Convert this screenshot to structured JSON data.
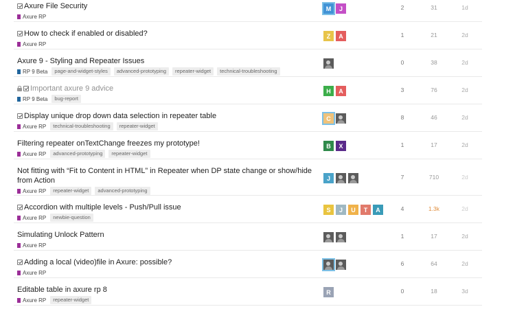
{
  "topics": [
    {
      "title": "Axure File Security",
      "status_icon": "checkbox-icon",
      "locked": false,
      "muted": false,
      "category": {
        "label": "Axure RP",
        "color": "#9b2e98"
      },
      "tags": [],
      "posters": [
        {
          "kind": "letter",
          "letter": "M",
          "color": "#4293d6",
          "ring": true
        },
        {
          "kind": "letter",
          "letter": "J",
          "color": "#c44fc6"
        }
      ],
      "replies": "2",
      "views": "31",
      "activity": "1d"
    },
    {
      "title": "How to check if enabled or disabled?",
      "status_icon": "checkbox-icon",
      "locked": false,
      "muted": false,
      "category": {
        "label": "Axure RP",
        "color": "#9b2e98"
      },
      "tags": [],
      "posters": [
        {
          "kind": "letter",
          "letter": "Z",
          "color": "#e8c44a"
        },
        {
          "kind": "letter",
          "letter": "A",
          "color": "#e45d5d"
        }
      ],
      "replies": "1",
      "views": "21",
      "activity": "2d"
    },
    {
      "title": "Axure 9 - Styling and Repeater Issues",
      "status_icon": "",
      "locked": false,
      "muted": false,
      "category": {
        "label": "RP 9 Beta",
        "color": "#22669d"
      },
      "tags": [
        "page-and-widget-styles",
        "advanced-prototyping",
        "repeater-widget",
        "technical-troubleshooting"
      ],
      "posters": [
        {
          "kind": "photo"
        }
      ],
      "replies": "0",
      "views": "38",
      "activity": "2d"
    },
    {
      "title": "Important axure 9 advice",
      "status_icon": "checkbox-icon",
      "locked": true,
      "muted": true,
      "category": {
        "label": "RP 9 Beta",
        "color": "#22669d"
      },
      "tags": [
        "bug-report"
      ],
      "posters": [
        {
          "kind": "letter",
          "letter": "H",
          "color": "#3cae4a"
        },
        {
          "kind": "letter",
          "letter": "A",
          "color": "#e45d5d"
        }
      ],
      "replies": "3",
      "views": "76",
      "activity": "2d"
    },
    {
      "title": "Display unique drop down data selection in repeater table",
      "status_icon": "checkbox-icon",
      "locked": false,
      "muted": false,
      "category": {
        "label": "Axure RP",
        "color": "#9b2e98"
      },
      "tags": [
        "technical-troubleshooting",
        "repeater-widget"
      ],
      "posters": [
        {
          "kind": "letter",
          "letter": "C",
          "color": "#efc27a",
          "ring": true
        },
        {
          "kind": "photo"
        }
      ],
      "replies": "8",
      "views": "46",
      "activity": "2d"
    },
    {
      "title": "Filtering repeater onTextChange freezes my prototype!",
      "status_icon": "",
      "locked": false,
      "muted": false,
      "category": {
        "label": "Axure RP",
        "color": "#9b2e98"
      },
      "tags": [
        "advanced-prototyping",
        "repeater-widget"
      ],
      "posters": [
        {
          "kind": "letter",
          "letter": "B",
          "color": "#2f8a4b"
        },
        {
          "kind": "letter",
          "letter": "X",
          "color": "#5a2a8a"
        }
      ],
      "replies": "1",
      "views": "17",
      "activity": "2d"
    },
    {
      "title": "Not fitting with “Fit to Content in HTML” in Repeater when DP state change or show/hide from Action",
      "status_icon": "",
      "locked": false,
      "muted": false,
      "category": {
        "label": "Axure RP",
        "color": "#9b2e98"
      },
      "tags": [
        "repeater-widget",
        "advanced-prototyping"
      ],
      "posters": [
        {
          "kind": "letter",
          "letter": "J",
          "color": "#4aa3c9"
        },
        {
          "kind": "photo"
        },
        {
          "kind": "photo"
        }
      ],
      "replies": "7",
      "views": "710",
      "activity": "2d"
    },
    {
      "title": "Accordion with multiple levels - Push/Pull issue",
      "status_icon": "checkbox-icon",
      "locked": false,
      "muted": false,
      "category": {
        "label": "Axure RP",
        "color": "#9b2e98"
      },
      "tags": [
        "newbie-question"
      ],
      "posters": [
        {
          "kind": "letter",
          "letter": "S",
          "color": "#e9c43f"
        },
        {
          "kind": "letter",
          "letter": "J",
          "color": "#9fb8c2"
        },
        {
          "kind": "letter",
          "letter": "U",
          "color": "#f0b24a"
        },
        {
          "kind": "letter",
          "letter": "T",
          "color": "#e17a6b"
        },
        {
          "kind": "letter",
          "letter": "A",
          "color": "#3a9bb8"
        }
      ],
      "replies": "4",
      "views": "1.3k",
      "activity": "2d"
    },
    {
      "title": "Simulating Unlock Pattern",
      "status_icon": "",
      "locked": false,
      "muted": false,
      "category": {
        "label": "Axure RP",
        "color": "#9b2e98"
      },
      "tags": [],
      "posters": [
        {
          "kind": "photo"
        },
        {
          "kind": "photo"
        }
      ],
      "replies": "1",
      "views": "17",
      "activity": "2d"
    },
    {
      "title": "Adding a local (video)file in Axure: possible?",
      "status_icon": "checkbox-icon",
      "locked": false,
      "muted": false,
      "category": {
        "label": "Axure RP",
        "color": "#9b2e98"
      },
      "tags": [],
      "posters": [
        {
          "kind": "photo",
          "ring": true
        },
        {
          "kind": "photo"
        }
      ],
      "replies": "6",
      "views": "64",
      "activity": "2d"
    },
    {
      "title": "Editable table in axure rp 8",
      "status_icon": "",
      "locked": false,
      "muted": false,
      "category": {
        "label": "Axure RP",
        "color": "#9b2e98"
      },
      "tags": [
        "repeater-widget"
      ],
      "posters": [
        {
          "kind": "letter",
          "letter": "R",
          "color": "#9aa3b5"
        }
      ],
      "replies": "0",
      "views": "18",
      "activity": "3d"
    }
  ]
}
